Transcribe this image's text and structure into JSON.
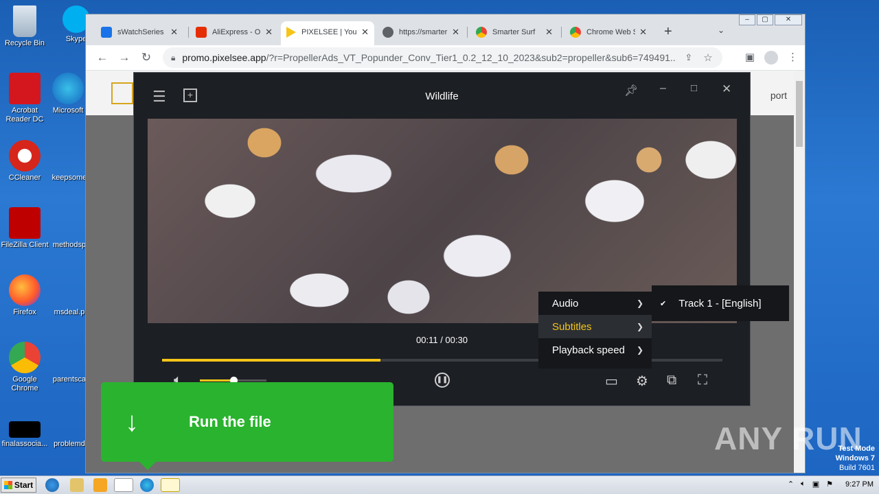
{
  "desktop": {
    "icons": [
      {
        "label": "Recycle Bin"
      },
      {
        "label": "Skype"
      },
      {
        "label": "Acrobat Reader DC"
      },
      {
        "label": "Microsoft"
      },
      {
        "label": "CCleaner"
      },
      {
        "label": "keepsome"
      },
      {
        "label": "FileZilla Client"
      },
      {
        "label": "methodsp"
      },
      {
        "label": "Firefox"
      },
      {
        "label": "msdeal.p"
      },
      {
        "label": "Google Chrome"
      },
      {
        "label": "parentsca"
      },
      {
        "label": "finalassocia..."
      },
      {
        "label": "problemd"
      }
    ]
  },
  "browser": {
    "tabs": [
      {
        "title": "sWatchSeries -",
        "color": "#1a73e8"
      },
      {
        "title": "AliExpress - On",
        "color": "#e62e04"
      },
      {
        "title": "PIXELSEE | You",
        "color": "#f5c518"
      },
      {
        "title": "https://smarter",
        "color": "#5f6368"
      },
      {
        "title": "Smarter Surf",
        "color": "#ea4335"
      },
      {
        "title": "Chrome Web S",
        "color": "#34a853"
      }
    ],
    "new_tab": "+",
    "url_host": "promo.pixelsee.app",
    "url_rest": "/?r=PropellerAds_VT_Popunder_Conv_Tier1_0.2_12_10_2023&sub2=propeller&sub6=749491...",
    "page_header_link": "port"
  },
  "player": {
    "title": "Wildlife",
    "time": "00:11 / 00:30",
    "progress": 0.39,
    "volume": 0.5,
    "menu": {
      "items": [
        {
          "label": "Audio"
        },
        {
          "label": "Subtitles"
        },
        {
          "label": "Playback speed"
        }
      ]
    },
    "submenu_track": "Track 1 - [English]"
  },
  "banner": {
    "label": "Run the file"
  },
  "watermark": {
    "text": "ANY RUN",
    "test_mode": "Test Mode",
    "os": "Windows 7",
    "build": "Build 7601"
  },
  "taskbar": {
    "start": "Start",
    "clock": "9:27 PM"
  }
}
